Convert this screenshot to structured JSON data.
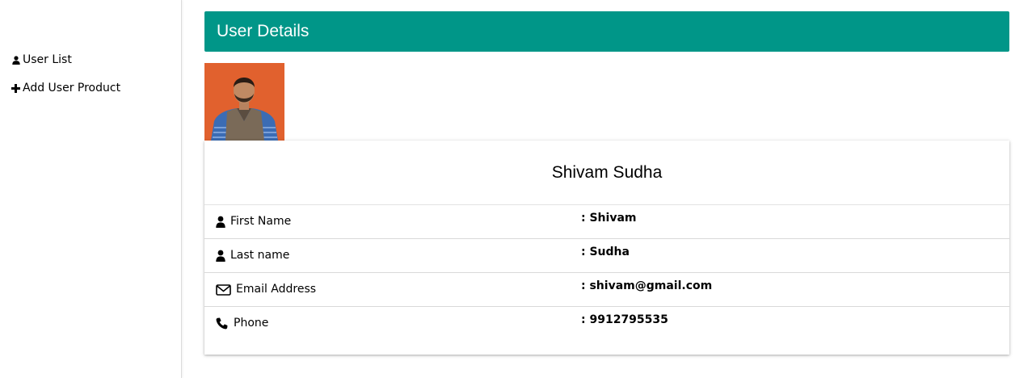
{
  "sidebar": {
    "items": [
      {
        "icon": "user-icon",
        "label": "User List"
      },
      {
        "icon": "plus-icon",
        "label": "Add User Product"
      }
    ]
  },
  "header": {
    "title": "User Details",
    "color": "#009688"
  },
  "profile": {
    "full_name": "Shivam Sudha",
    "fields": [
      {
        "icon": "user-icon",
        "label": "First Name",
        "value": ": Shivam"
      },
      {
        "icon": "user-icon",
        "label": "Last name",
        "value": ": Sudha"
      },
      {
        "icon": "envelope-icon",
        "label": "Email Address",
        "value": ": shivam@gmail.com"
      },
      {
        "icon": "phone-icon",
        "label": "Phone",
        "value": ": 9912795535"
      }
    ]
  }
}
